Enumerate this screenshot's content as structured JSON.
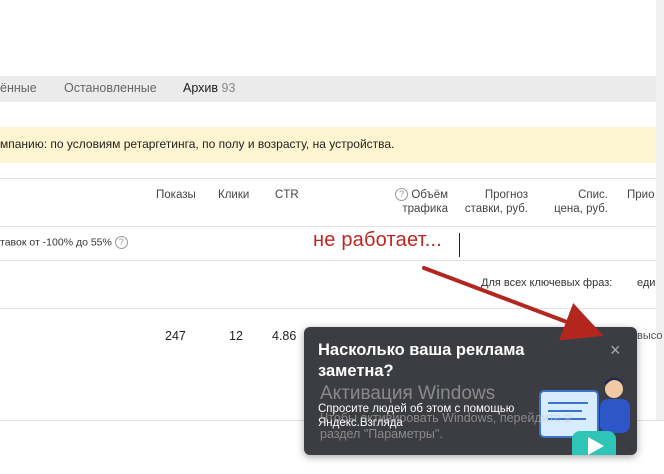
{
  "tabs": [
    {
      "label": "ённые",
      "count": ""
    },
    {
      "label": "Остановленные",
      "count": ""
    },
    {
      "label": "Архив",
      "count": "93"
    }
  ],
  "banner": {
    "text": "мпанию: по условиям ретаргетинга, по полу и возрасту, на устройства."
  },
  "table": {
    "headers": {
      "shows": "Показы",
      "clicks": "Клики",
      "ctr": "CTR",
      "traffic_1": "Объём",
      "traffic_2": "трафика",
      "forecast_1": "Прогноз",
      "forecast_2": "ставки, руб.",
      "price_1": "Спис.",
      "price_2": "цена, руб.",
      "priority": "Прио"
    },
    "bid_adjust": "тавок от -100% до 55%",
    "all_phrases_label": "Для всех ключевых фраз:",
    "all_phrases_value": "еди",
    "row": {
      "shows": "247",
      "clicks": "12",
      "ctr": "4.86",
      "right_cut": "высо"
    }
  },
  "annotation": {
    "text": "не работает..."
  },
  "popup": {
    "title": "Насколько ваша реклама заметна?",
    "subtitle": "Спросите людей об этом с помощью Яндекс.Взгляда",
    "close_glyph": "×"
  },
  "watermark": {
    "line1": "Активация Windows",
    "line2": "Чтобы активировать Windows, перейдите в",
    "line3": "раздел \"Параметры\"."
  },
  "colors": {
    "annotation": "#c0261f",
    "banner_bg": "#fdf5d0",
    "popup_bg": "#3c3d42",
    "accent_teal": "#2ec4b6"
  }
}
